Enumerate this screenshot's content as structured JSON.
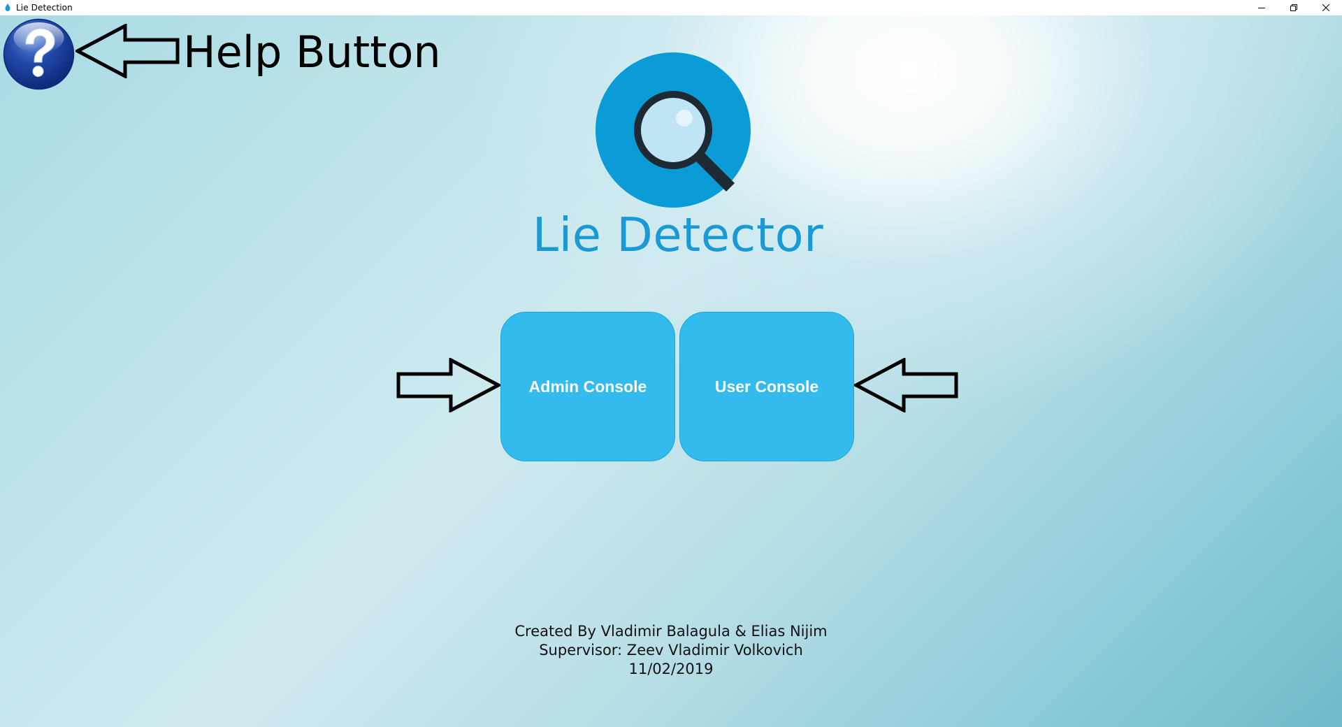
{
  "window": {
    "title": "Lie Detection",
    "controls": [
      "minimize-icon",
      "restore-icon",
      "close-icon"
    ]
  },
  "help": {
    "icon": "question-mark-icon",
    "annotation": "Help Button"
  },
  "logo": {
    "icon": "magnifying-glass-icon",
    "text": "Lie Detector"
  },
  "buttons": {
    "admin_label": "Admin Console",
    "user_label": "User Console"
  },
  "credits": {
    "created_by": "Created By Vladimir Balagula & Elias Nijim",
    "supervisor": "Supervisor: Zeev Vladimir Volkovich",
    "date": "11/02/2019"
  },
  "colors": {
    "button_fill": "#33bbed",
    "logo_blue": "#0b9bd6",
    "logo_text": "#1a9ad4"
  }
}
